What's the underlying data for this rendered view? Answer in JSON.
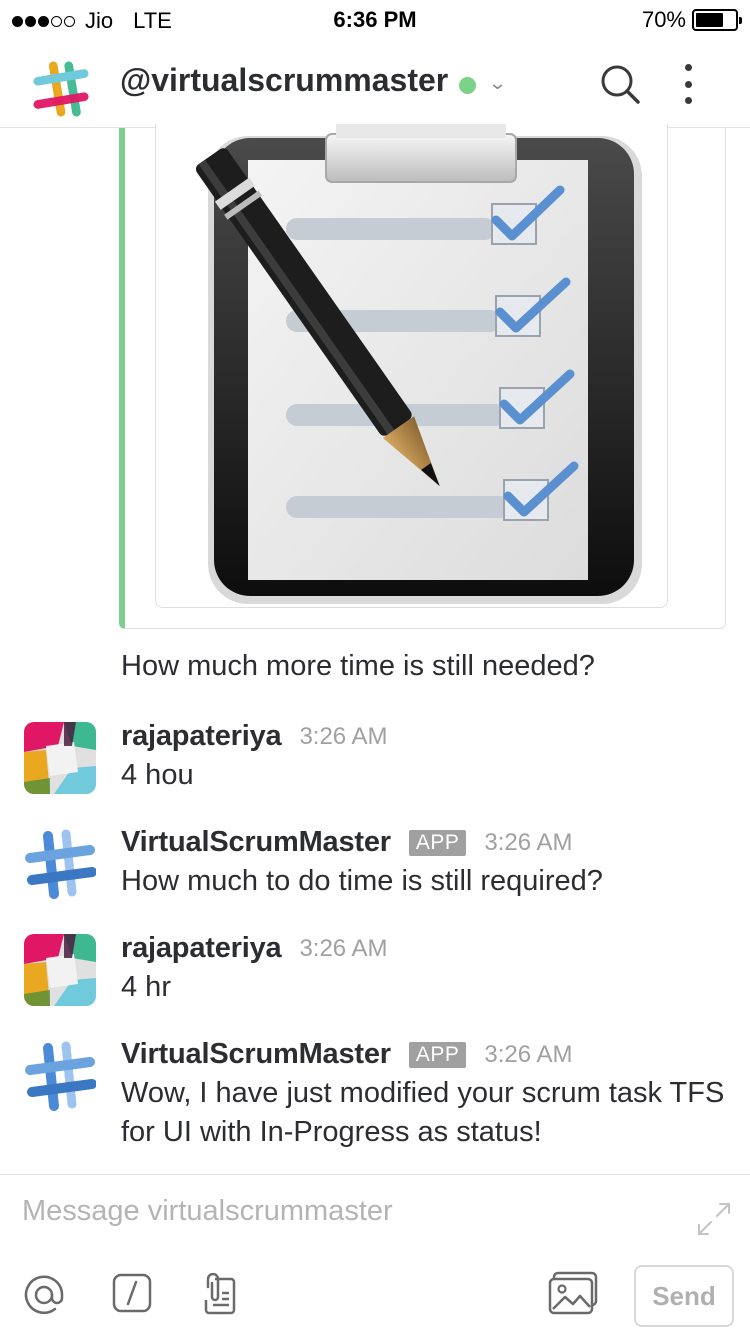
{
  "status_bar": {
    "carrier": "Jio",
    "network": "LTE",
    "time": "6:36 PM",
    "battery": "70%",
    "battery_level": 0.7
  },
  "header": {
    "title": "@virtualscrummaster",
    "presence_color": "#7bd389"
  },
  "attachment": {
    "accent_color": "#7ccf8f",
    "image": "checklist-clipboard-with-pencil"
  },
  "prompt_text": "How much more time is still needed?",
  "messages": [
    {
      "author": "rajapateriya",
      "time": "3:26 AM",
      "text": "4 hou"
    },
    {
      "author": "VirtualScrumMaster",
      "badge": "APP",
      "time": "3:26 AM",
      "text": "How much to do time is still required?"
    },
    {
      "author": "rajapateriya",
      "time": "3:26 AM",
      "text": "4 hr"
    },
    {
      "author": "VirtualScrumMaster",
      "badge": "APP",
      "time": "3:26 AM",
      "text": "Wow, I have just modified your scrum task TFS for UI with In-Progress as status!"
    }
  ],
  "composer": {
    "placeholder": "Message virtualscrummaster",
    "send_label": "Send"
  },
  "icons": [
    "slack-logo",
    "chevron-down-icon",
    "search-icon",
    "more-icon",
    "at-icon",
    "slash-command-icon",
    "attach-file-icon",
    "photo-icon",
    "expand-icon"
  ]
}
